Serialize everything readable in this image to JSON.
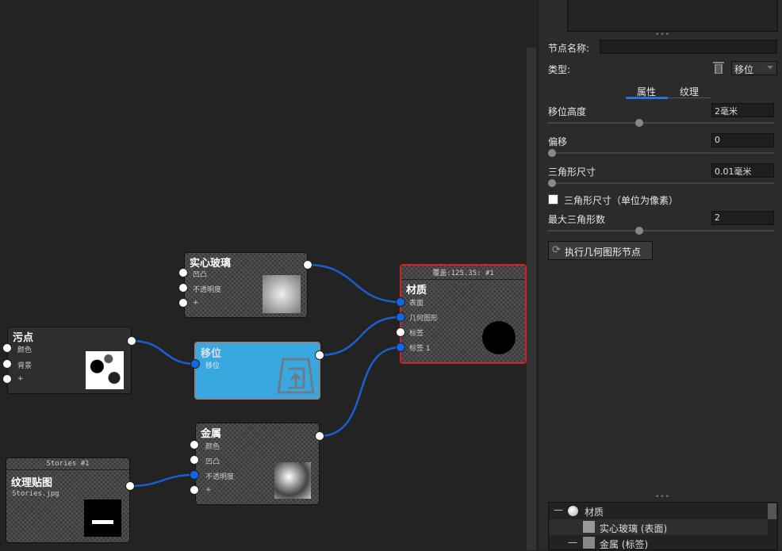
{
  "nodes": {
    "glass": {
      "title": "实心玻璃",
      "ports": [
        "凹凸",
        "不透明度",
        "+"
      ]
    },
    "material": {
      "header": "覆盖:125.35: #1",
      "title": "材质",
      "ports": [
        "表面",
        "几何图形",
        "标签",
        "标签 1"
      ]
    },
    "stain": {
      "title": "污点",
      "ports": [
        "颜色",
        "背景",
        "+"
      ]
    },
    "displace": {
      "title": "移位",
      "ports": [
        "移位"
      ]
    },
    "metal": {
      "title": "金属",
      "ports": [
        "颜色",
        "凹凸",
        "不透明度",
        "+"
      ]
    },
    "texture": {
      "header": "Stories #1",
      "title": "纹理贴图",
      "file": "Stories.jpg"
    }
  },
  "panel": {
    "dots": "•••",
    "node_name_label": "节点名称:",
    "node_name_value": "",
    "type_label": "类型:",
    "type_value": "移位",
    "tabs": [
      "属性",
      "纹理"
    ],
    "props": [
      {
        "label": "移位高度",
        "value": "2毫米",
        "slider": 0.5
      },
      {
        "label": "偏移",
        "value": "0",
        "slider": 0
      },
      {
        "label": "三角形尺寸",
        "value": "0.01毫米",
        "slider": 0
      }
    ],
    "checkbox_label": "三角形尺寸（单位为像素）",
    "max_tri_label": "最大三角形数",
    "max_tri_value": "2",
    "max_tri_slider": 0.5,
    "exec_button": "执行几何图形节点",
    "tree": [
      {
        "label": "材质"
      },
      {
        "label": "实心玻璃 (表面)"
      },
      {
        "label": "金属 (标签)"
      }
    ]
  },
  "colors": {
    "accent": "#1464e6",
    "selected": "#d42020",
    "displace": "#3aa8e0"
  }
}
